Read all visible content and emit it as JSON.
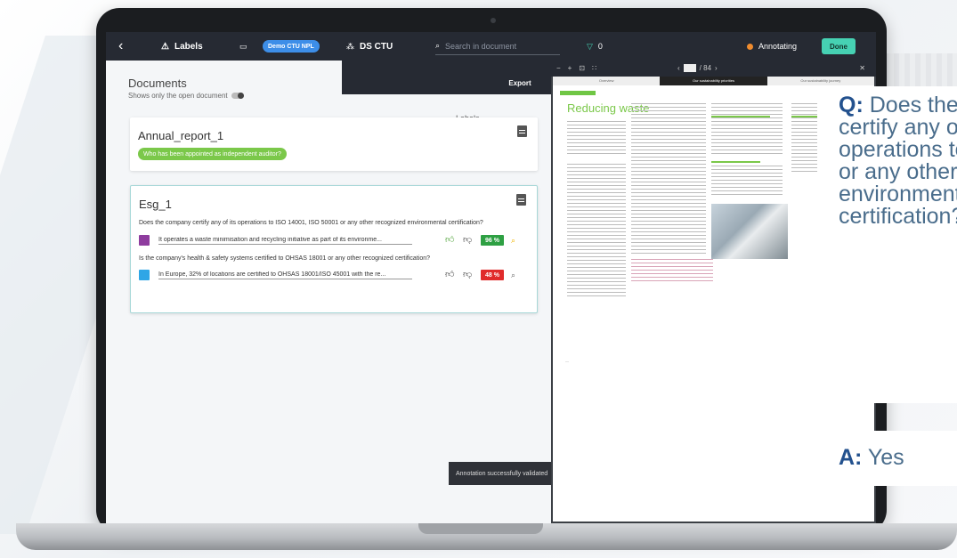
{
  "topbar": {
    "back_icon": "back-arrow-icon",
    "app_title": "Labels",
    "project_badge": "Demo CTU NPL",
    "dataset": "DS CTU",
    "search_placeholder": "Search in document",
    "filter_count": "0",
    "status": "Annotating",
    "done_label": "Done",
    "status_color": "#f08c2e",
    "accent_color": "#46d1b3"
  },
  "panel": {
    "title": "Documents",
    "subtitle": "Shows only the open document",
    "labels_dropdown": "Labels",
    "export_label": "Export"
  },
  "documents": [
    {
      "name": "Annual_report_1",
      "question_chip": "Who has been appointed as independent auditor?"
    },
    {
      "name": "Esg_1",
      "questions": [
        {
          "question": "Does the company certify any of its operations to ISO 14001, ISO 50001 or any other recognized environmental certification?",
          "answer": "It operates a waste minimisation and recycling initiative as part of its environme...",
          "score": "96 %",
          "score_color": "#2ea043",
          "label_color": "#8e3c9e"
        },
        {
          "question": "Is the company's health & safety systems certified to OHSAS 18001 or any other recognized certification?",
          "answer": "In Europe, 32% of locations are certified to OHSAS 18001/ISO 45001 with the re...",
          "score": "48 %",
          "score_color": "#e02b2b",
          "label_color": "#2fa6e6"
        }
      ]
    }
  ],
  "toast": "Annotation successfully validated",
  "viewer": {
    "page_of": "/ 84",
    "doc_heading": "Reducing waste",
    "tab_overview": "Overview",
    "tab_priorities": "Our sustainability priorities",
    "tab_third": "Our sustainability journey"
  },
  "qa": {
    "q_prefix": "Q:",
    "question_lines": [
      "Does the company",
      "certify any of its",
      "operations to ISO",
      "or any other recognized",
      "environmental",
      "certification?"
    ],
    "a_prefix": "A:",
    "answer": "Yes"
  }
}
